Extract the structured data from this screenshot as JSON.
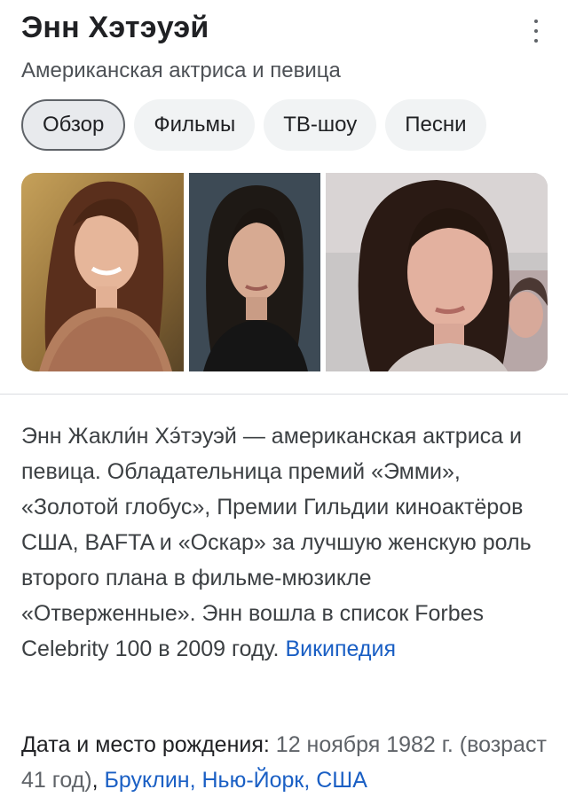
{
  "header": {
    "title": "Энн Хэтэуэй",
    "subtitle": "Американская актриса и певица",
    "more_icon": "more-vert-icon"
  },
  "tabs": [
    {
      "label": "Обзор",
      "active": true
    },
    {
      "label": "Фильмы",
      "active": false
    },
    {
      "label": "ТВ-шоу",
      "active": false
    },
    {
      "label": "Песни",
      "active": false
    }
  ],
  "photos": [
    {
      "name": "photo-1"
    },
    {
      "name": "photo-2"
    },
    {
      "name": "photo-3"
    }
  ],
  "description": {
    "text": "Энн Жакли́н Хэ́тэуэй — американская актриса и певица. Обладательница премий «Эмми», «Золотой глобус», Премии Гильдии киноактёров США, BAFTA и «Оскар» за лучшую женскую роль второго плана в фильме-мюзикле «Отверженные». Энн вошла в список Forbes Celebrity 100 в 2009 году.",
    "source_link": "Википедия"
  },
  "birth": {
    "label": "Дата и место рождения",
    "date": "12 ноября 1982 г. (возраст 41 год)",
    "place": "Бруклин, Нью-Йорк, США"
  },
  "colors": {
    "link": "#1a5fc4",
    "text": "#202124",
    "secondary": "#4d5156",
    "chip_bg": "#f1f3f4"
  }
}
